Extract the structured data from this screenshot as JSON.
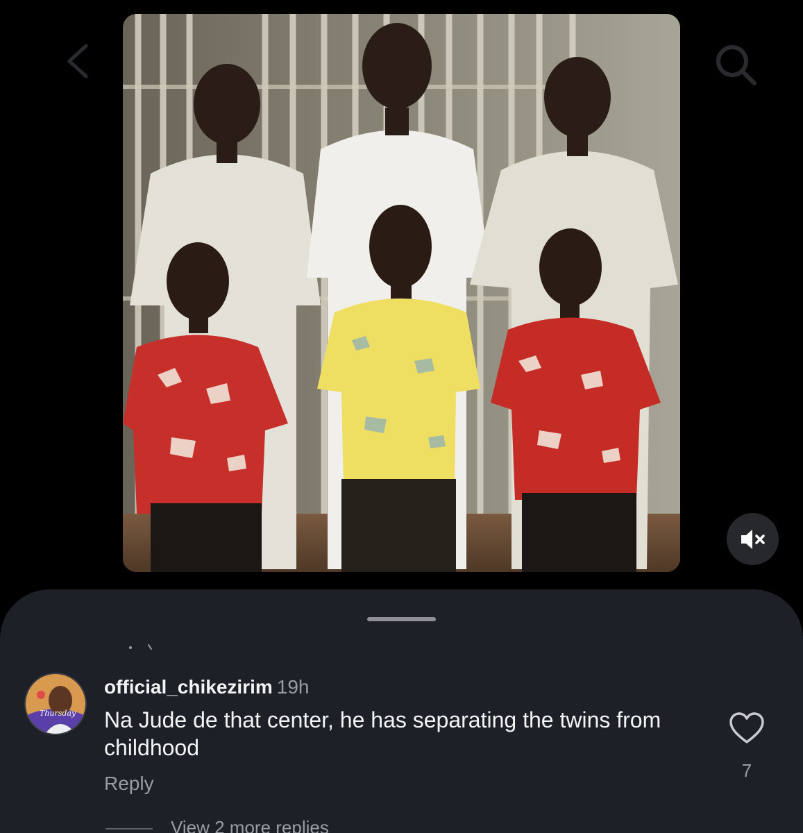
{
  "header": {
    "back_icon": "chevron-left-icon",
    "search_icon": "search-icon"
  },
  "post": {
    "media_description_icon": "photo",
    "mute_icon": "speaker-muted-icon"
  },
  "comment_sheet": {
    "handle": "drag-handle",
    "comment": {
      "username": "official_chikezirim",
      "time": "19h",
      "text": "Na Jude de that center, he has separating the twins from childhood",
      "reply_label": "Reply",
      "like_icon": "heart-icon",
      "like_count": "7",
      "avatar_caption": "Thursday"
    },
    "view_replies_label": "View 2 more replies"
  },
  "colors": {
    "background": "#000000",
    "sheet": "#1d2026",
    "primary_text": "#f2f3f5",
    "secondary_text": "#9a9ca3",
    "mute_button": "#26282c"
  }
}
